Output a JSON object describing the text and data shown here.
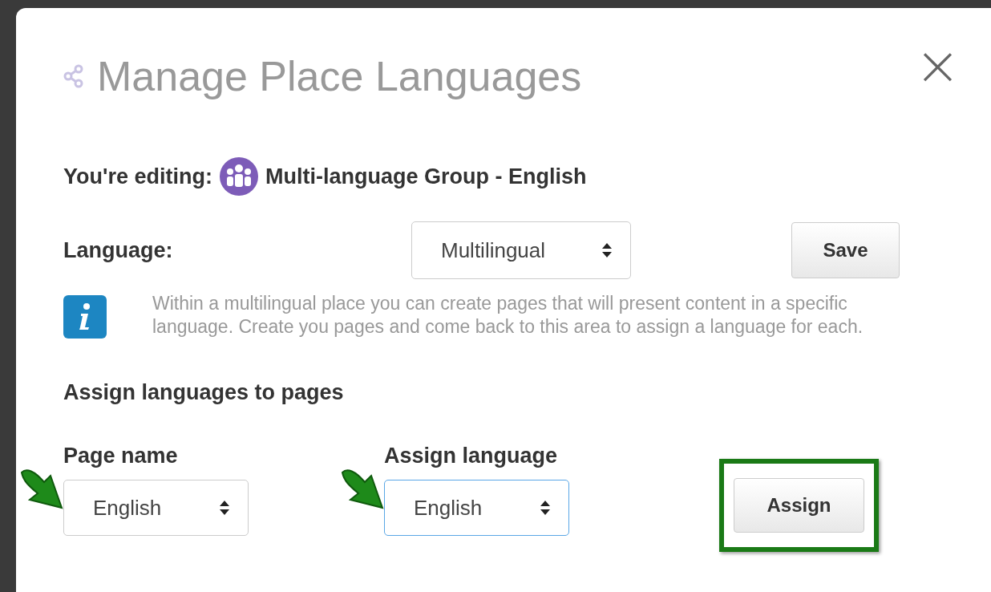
{
  "dialog": {
    "title": "Manage Place Languages",
    "close": "×"
  },
  "editing": {
    "label": "You're editing:",
    "place": "Multi-language Group - English"
  },
  "language": {
    "label": "Language:",
    "value": "Multilingual",
    "save": "Save"
  },
  "info": "Within a multilingual place you can create pages that will present content in a specific language. Create you pages and come back to this area to assign a language for each.",
  "assign_section": {
    "heading": "Assign languages to pages",
    "fields": [
      {
        "label": "Page name",
        "value": "English",
        "focused": false,
        "pointed": true
      },
      {
        "label": "Assign language",
        "value": "English",
        "focused": true,
        "pointed": true
      }
    ],
    "button": "Assign",
    "button_highlighted": true
  }
}
